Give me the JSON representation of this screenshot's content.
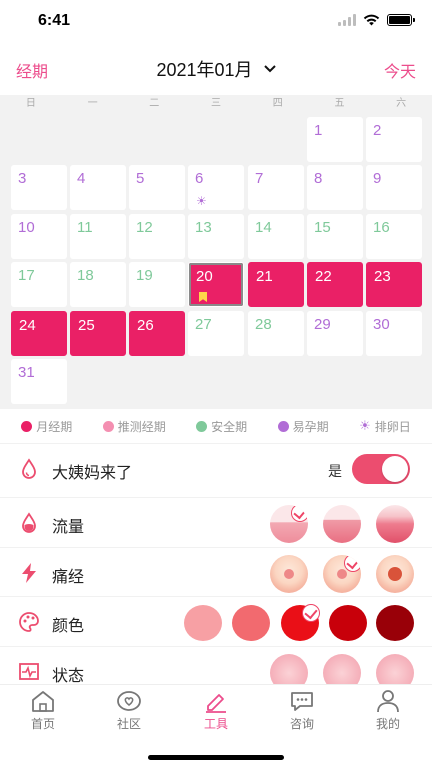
{
  "status_bar": {
    "time": "6:41"
  },
  "header": {
    "left": "经期",
    "title": "2021年01月",
    "right": "今天"
  },
  "calendar": {
    "weekdays": [
      "日",
      "一",
      "二",
      "三",
      "四",
      "五",
      "六"
    ],
    "days": [
      {
        "n": "1",
        "type": "purple"
      },
      {
        "n": "2",
        "type": "purple"
      },
      {
        "n": "3",
        "type": "purple"
      },
      {
        "n": "4",
        "type": "purple"
      },
      {
        "n": "5",
        "type": "purple"
      },
      {
        "n": "6",
        "type": "purple",
        "ovulation": true
      },
      {
        "n": "7",
        "type": "purple"
      },
      {
        "n": "8",
        "type": "purple"
      },
      {
        "n": "9",
        "type": "purple"
      },
      {
        "n": "10",
        "type": "purple"
      },
      {
        "n": "11",
        "type": "green"
      },
      {
        "n": "12",
        "type": "green"
      },
      {
        "n": "13",
        "type": "green"
      },
      {
        "n": "14",
        "type": "green"
      },
      {
        "n": "15",
        "type": "green"
      },
      {
        "n": "16",
        "type": "green"
      },
      {
        "n": "17",
        "type": "green"
      },
      {
        "n": "18",
        "type": "green"
      },
      {
        "n": "19",
        "type": "green"
      },
      {
        "n": "20",
        "type": "period",
        "today": true,
        "flag": true
      },
      {
        "n": "21",
        "type": "period"
      },
      {
        "n": "22",
        "type": "period"
      },
      {
        "n": "23",
        "type": "period"
      },
      {
        "n": "24",
        "type": "period"
      },
      {
        "n": "25",
        "type": "period"
      },
      {
        "n": "26",
        "type": "period"
      },
      {
        "n": "27",
        "type": "green"
      },
      {
        "n": "28",
        "type": "green"
      },
      {
        "n": "29",
        "type": "purple"
      },
      {
        "n": "30",
        "type": "purple"
      },
      {
        "n": "31",
        "type": "purple"
      }
    ]
  },
  "legend": [
    {
      "label": "月经期",
      "color": "#ea2066"
    },
    {
      "label": "推测经期",
      "color": "#f48fb1"
    },
    {
      "label": "安全期",
      "color": "#7fc99a"
    },
    {
      "label": "易孕期",
      "color": "#b16dd6"
    },
    {
      "label": "排卵日",
      "icon": "sun-icon"
    }
  ],
  "rows": {
    "period": {
      "label": "大姨妈来了",
      "toggle_text": "是",
      "toggle_on": true
    },
    "flow": {
      "label": "流量",
      "selected_index": 0
    },
    "pain": {
      "label": "痛经",
      "selected_index": 1
    },
    "color": {
      "label": "颜色",
      "swatches": [
        "#f7a0a4",
        "#f26a6f",
        "#ea0f17",
        "#c8000a",
        "#990008"
      ],
      "selected_index": 2
    },
    "state": {
      "label": "状态"
    }
  },
  "tabbar": [
    {
      "label": "首页",
      "icon": "home-icon"
    },
    {
      "label": "社区",
      "icon": "community-icon"
    },
    {
      "label": "工具",
      "icon": "tools-icon",
      "active": true
    },
    {
      "label": "咨询",
      "icon": "chat-icon"
    },
    {
      "label": "我的",
      "icon": "profile-icon"
    }
  ],
  "colors": {
    "accent": "#ec4d8c",
    "period": "#ea2066"
  }
}
